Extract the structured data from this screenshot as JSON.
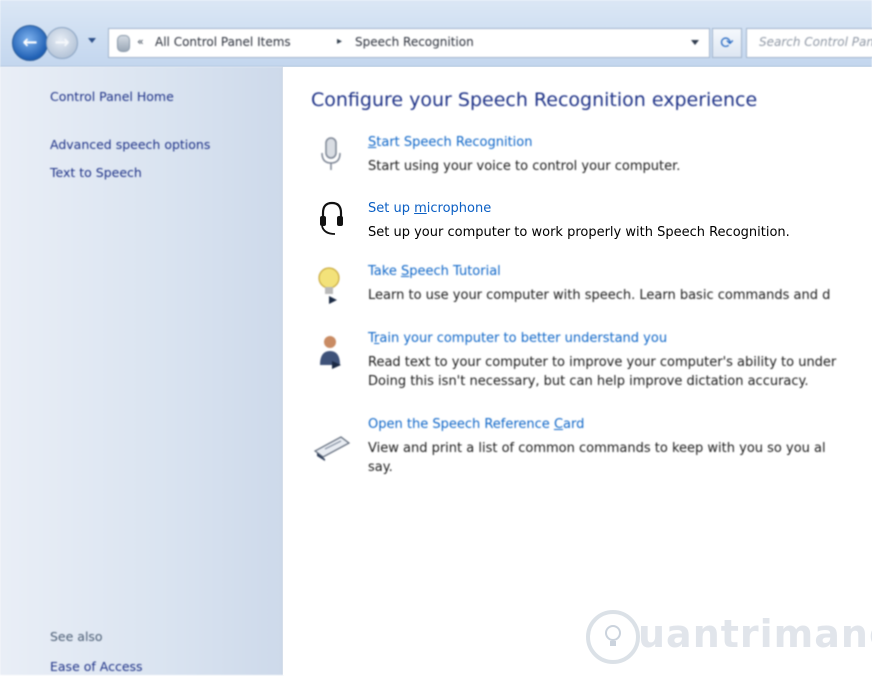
{
  "address_bar": {
    "separator1": "«",
    "crumb1": "All Control Panel Items",
    "separator2": "▸",
    "crumb2": "Speech Recognition",
    "refresh_glyph": "⟳",
    "search_placeholder": "Search Control Panel"
  },
  "icons": {
    "back": "back-arrow-icon",
    "forward": "forward-arrow-icon",
    "control_panel": "control-panel-icon",
    "microphone": "microphone-icon",
    "headset": "headset-icon",
    "bulb": "lightbulb-icon",
    "person": "user-training-icon",
    "card": "reference-card-icon"
  },
  "left_pane": {
    "home": "Control Panel Home",
    "links": [
      "Advanced speech options",
      "Text to Speech"
    ],
    "see_also_label": "See also",
    "see_also_links": [
      "Ease of Access"
    ]
  },
  "main": {
    "title": "Configure your Speech Recognition experience",
    "tasks": [
      {
        "link_pre": "",
        "link_ul": "S",
        "link_post": "tart Speech Recognition",
        "desc": [
          "Start using your voice to control your computer."
        ]
      },
      {
        "link_pre": "Set up ",
        "link_ul": "m",
        "link_post": "icrophone",
        "desc": [
          "Set up your computer to work properly with Speech Recognition."
        ]
      },
      {
        "link_pre": "Take ",
        "link_ul": "S",
        "link_post": "peech Tutorial",
        "desc": [
          "Learn to use your computer with speech.  Learn basic commands and d"
        ]
      },
      {
        "link_pre": "T",
        "link_ul": "r",
        "link_post": "ain your computer to better understand you",
        "desc": [
          "Read text to your computer to improve your computer's ability to under",
          "Doing this isn't necessary, but can help improve dictation accuracy."
        ]
      },
      {
        "link_pre": "Open the Speech Reference ",
        "link_ul": "C",
        "link_post": "ard",
        "desc": [
          "View and print a list of common commands to keep with you so you al",
          "say."
        ]
      }
    ]
  },
  "watermark": "uantrimang",
  "colors": {
    "link": "#0e66c8",
    "title": "#1e3287",
    "nav": "#1e3287"
  }
}
